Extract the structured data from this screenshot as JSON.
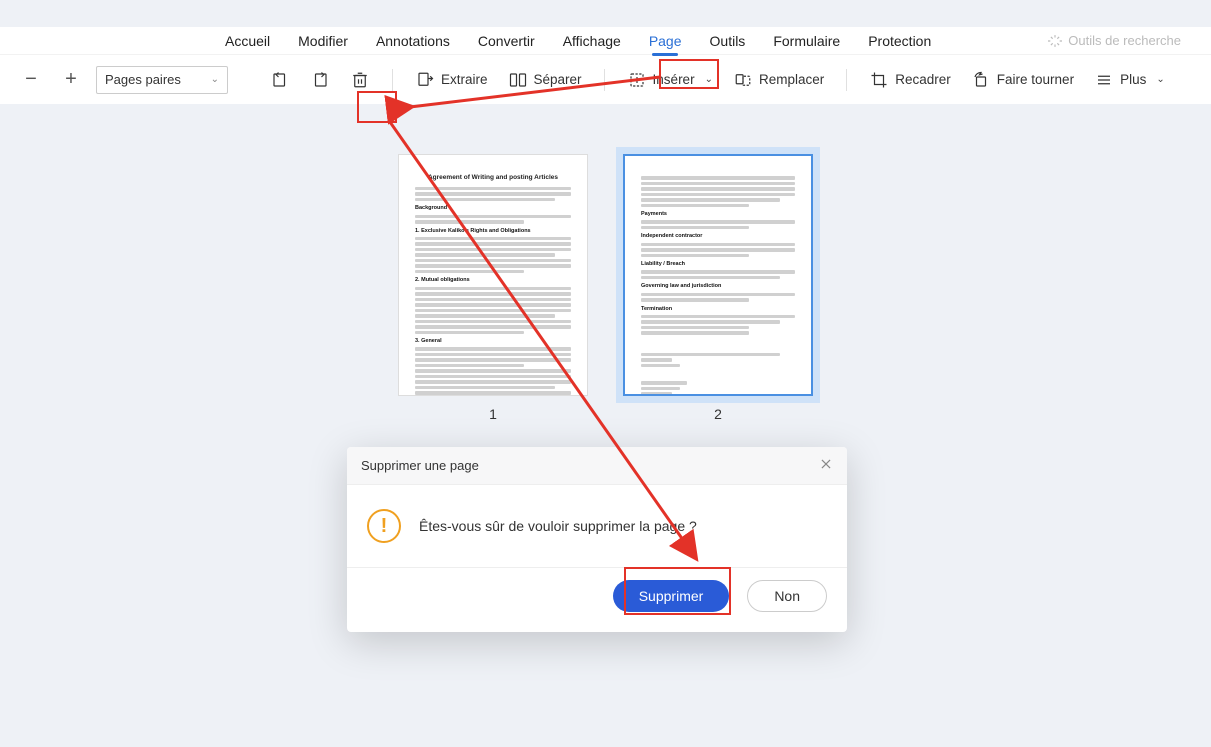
{
  "tabs": {
    "accueil": "Accueil",
    "modifier": "Modifier",
    "annotations": "Annotations",
    "convertir": "Convertir",
    "affichage": "Affichage",
    "page": "Page",
    "outils": "Outils",
    "formulaire": "Formulaire",
    "protection": "Protection"
  },
  "search_tools": "Outils de recherche",
  "toolbar": {
    "pages_paires": "Pages paires",
    "extraire": "Extraire",
    "separer": "Séparer",
    "inserer": "Insérer",
    "remplacer": "Remplacer",
    "recadrer": "Recadrer",
    "faire_tourner": "Faire tourner",
    "plus": "Plus"
  },
  "pages": {
    "p1_num": "1",
    "p2_num": "2",
    "p1_title": "Agreement of Writing and posting Articles"
  },
  "dialog": {
    "title": "Supprimer une page",
    "message": "Êtes-vous sûr de vouloir supprimer la page ?",
    "confirm": "Supprimer",
    "cancel": "Non"
  }
}
